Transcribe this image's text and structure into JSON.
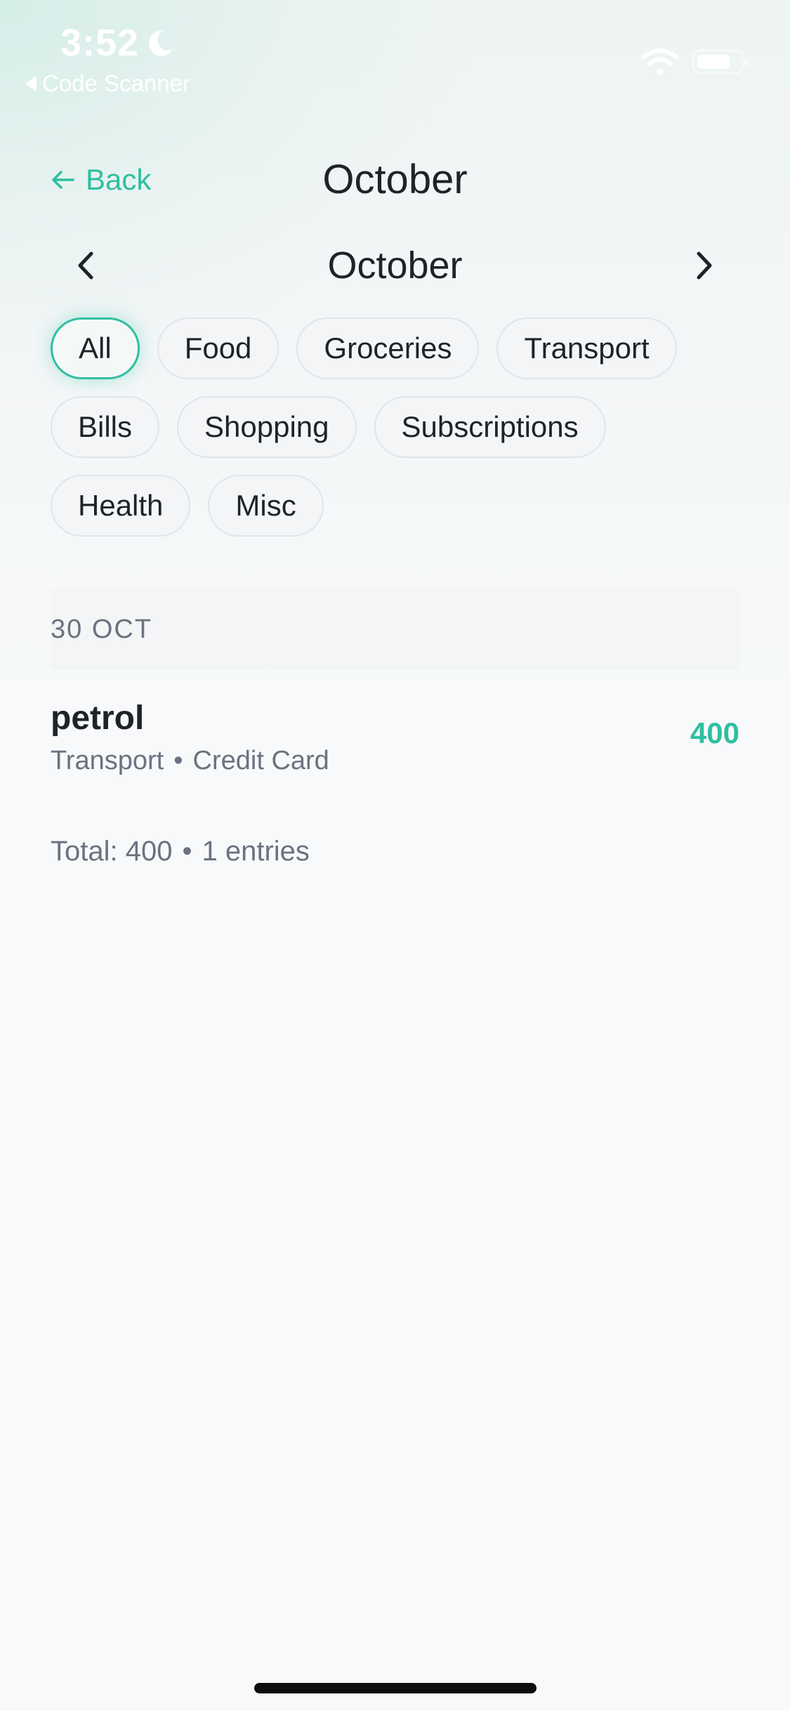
{
  "status_bar": {
    "time": "3:52",
    "back_app": "Code Scanner"
  },
  "header": {
    "back_label": "Back",
    "title": "October"
  },
  "month_nav": {
    "label": "October",
    "prev": "‹",
    "next": "›"
  },
  "filters": [
    {
      "label": "All",
      "selected": true
    },
    {
      "label": "Food",
      "selected": false
    },
    {
      "label": "Groceries",
      "selected": false
    },
    {
      "label": "Transport",
      "selected": false
    },
    {
      "label": "Bills",
      "selected": false
    },
    {
      "label": "Shopping",
      "selected": false
    },
    {
      "label": "Subscriptions",
      "selected": false
    },
    {
      "label": "Health",
      "selected": false
    },
    {
      "label": "Misc",
      "selected": false
    }
  ],
  "groups": [
    {
      "date": "30 OCT",
      "entries": [
        {
          "title": "petrol",
          "category": "Transport",
          "separator": "•",
          "method": "Credit Card",
          "amount": "400"
        }
      ]
    }
  ],
  "summary": {
    "total_text": "Total: 400",
    "separator": "•",
    "count_text": "1 entries"
  },
  "colors": {
    "accent": "#2fbfa0",
    "text": "#1f2328",
    "muted": "#6b7280",
    "background": "#f7f9fb"
  }
}
